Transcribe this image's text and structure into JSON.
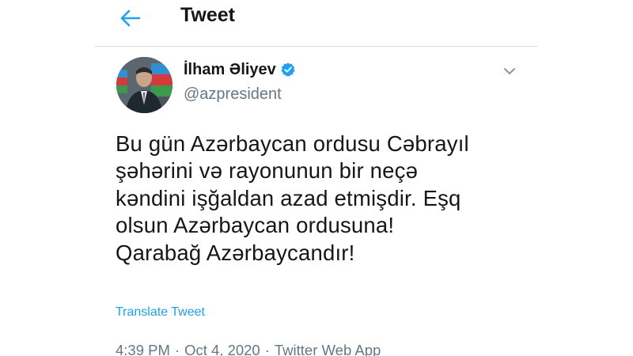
{
  "header": {
    "back_icon": "arrow-left-icon",
    "title": "Tweet"
  },
  "author": {
    "name": "İlham Əliyev",
    "handle": "@azpresident",
    "verified_icon": "verified-badge-icon"
  },
  "tweet": {
    "text": "Bu gün Azərbaycan ordusu Cəbrayıl\nşəhərini  və rayonunun bir neçə\nkəndini işğaldan azad etmişdir. Eşq\nolsun Azərbaycan ordusuna!\nQarabağ Azərbaycandır!",
    "translate_label": "Translate Tweet",
    "time": "4:39 PM",
    "date": "Oct 4, 2020",
    "source": "Twitter Web App",
    "separator": "·"
  },
  "colors": {
    "accent": "#1da1f2",
    "text": "#14171a",
    "secondary": "#657786",
    "divider": "#d9dde0"
  }
}
